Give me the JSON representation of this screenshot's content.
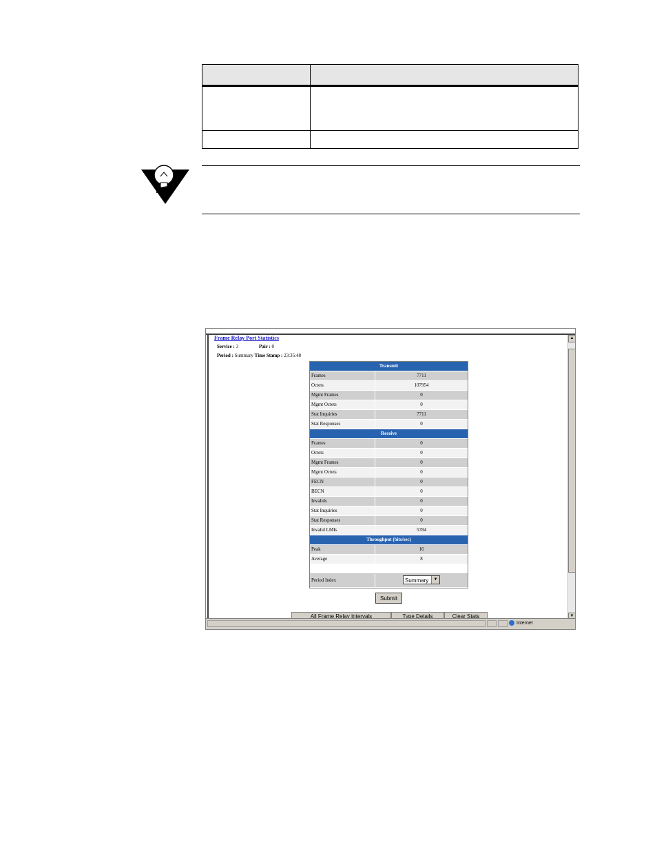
{
  "window": {
    "page_title": "Frame Relay Port Statistics",
    "service_label": "Service :",
    "service_value": "3",
    "pair_label": "Pair :",
    "pair_value": "0",
    "period_label": "Period :",
    "period_value": "Summary",
    "timestamp_label": "Time Stamp :",
    "timestamp_value": "23:35:48"
  },
  "stats": {
    "transmit_header": "Transmit",
    "transmit": [
      {
        "label": "Frames",
        "value": "7711"
      },
      {
        "label": "Octets",
        "value": "107954"
      },
      {
        "label": "Mgmt Frames",
        "value": "0"
      },
      {
        "label": "Mgmt Octets",
        "value": "0"
      },
      {
        "label": "Stat Inquiries",
        "value": "7711"
      },
      {
        "label": "Stat Responses",
        "value": "0"
      }
    ],
    "receive_header": "Receive",
    "receive": [
      {
        "label": "Frames",
        "value": "0"
      },
      {
        "label": "Octets",
        "value": "0"
      },
      {
        "label": "Mgmt Frames",
        "value": "0"
      },
      {
        "label": "Mgmt Octets",
        "value": "0"
      },
      {
        "label": "FECN",
        "value": "0"
      },
      {
        "label": "BECN",
        "value": "0"
      },
      {
        "label": "Invalids",
        "value": "0"
      },
      {
        "label": "Stat Inquiries",
        "value": "0"
      },
      {
        "label": "Stat Responses",
        "value": "0"
      },
      {
        "label": "Invalid LMIs",
        "value": "5784"
      }
    ],
    "throughput_header": "Throughput (bits/sec)",
    "throughput": [
      {
        "label": "Peak",
        "value": "16"
      },
      {
        "label": "Average",
        "value": "8"
      }
    ],
    "period_index_label": "Period Index",
    "period_index_selected": "Summary"
  },
  "buttons": {
    "submit": "Submit"
  },
  "tabs": [
    {
      "label": "All Frame Relay Intervals"
    },
    {
      "label": "Type Details"
    },
    {
      "label": "Clear Stats"
    }
  ],
  "statusbar": {
    "zone": "Internet"
  },
  "icons": {
    "note": "lightbulb-icon",
    "scroll_up": "scroll-up-arrow-icon",
    "scroll_down": "scroll-down-arrow-icon",
    "dropdown": "chevron-down-icon",
    "zone": "globe-icon"
  },
  "colors": {
    "section_header": "#2863b0",
    "link": "#1515c8"
  }
}
